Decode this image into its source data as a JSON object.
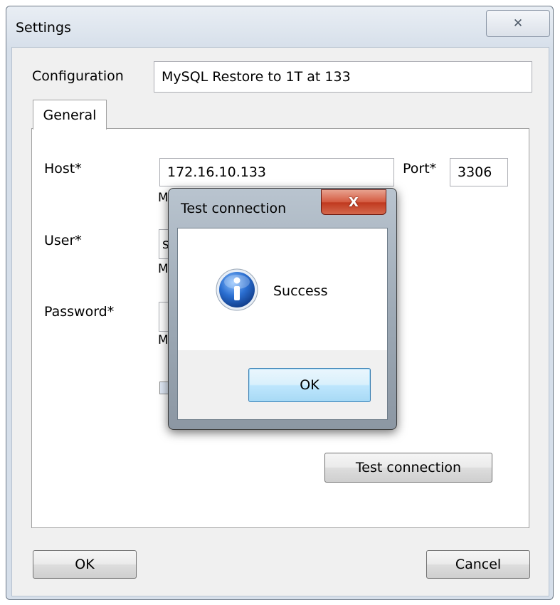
{
  "settings_window": {
    "title": "Settings",
    "close_glyph": "✕",
    "configuration_label": "Configuration",
    "configuration_value": "MySQL Restore to 1T at 133",
    "tabs": [
      {
        "label": "General"
      }
    ],
    "fields": {
      "host_label": "Host*",
      "host_value": "172.16.10.133",
      "port_label": "Port*",
      "port_value": "3306",
      "user_label": "User*",
      "password_label": "Password*",
      "hint_partial": "M",
      "user_partial": "s"
    },
    "test_connection_button": "Test connection",
    "ok_button": "OK",
    "cancel_button": "Cancel"
  },
  "test_connection_dialog": {
    "title": "Test connection",
    "close_glyph": "X",
    "message": "Success",
    "icon": "info-icon",
    "ok_button": "OK"
  },
  "colors": {
    "info_icon_blue": "#1f5fbf",
    "close_button_red": "#c7432a",
    "ok_button_blue": "#3c7fb1"
  }
}
